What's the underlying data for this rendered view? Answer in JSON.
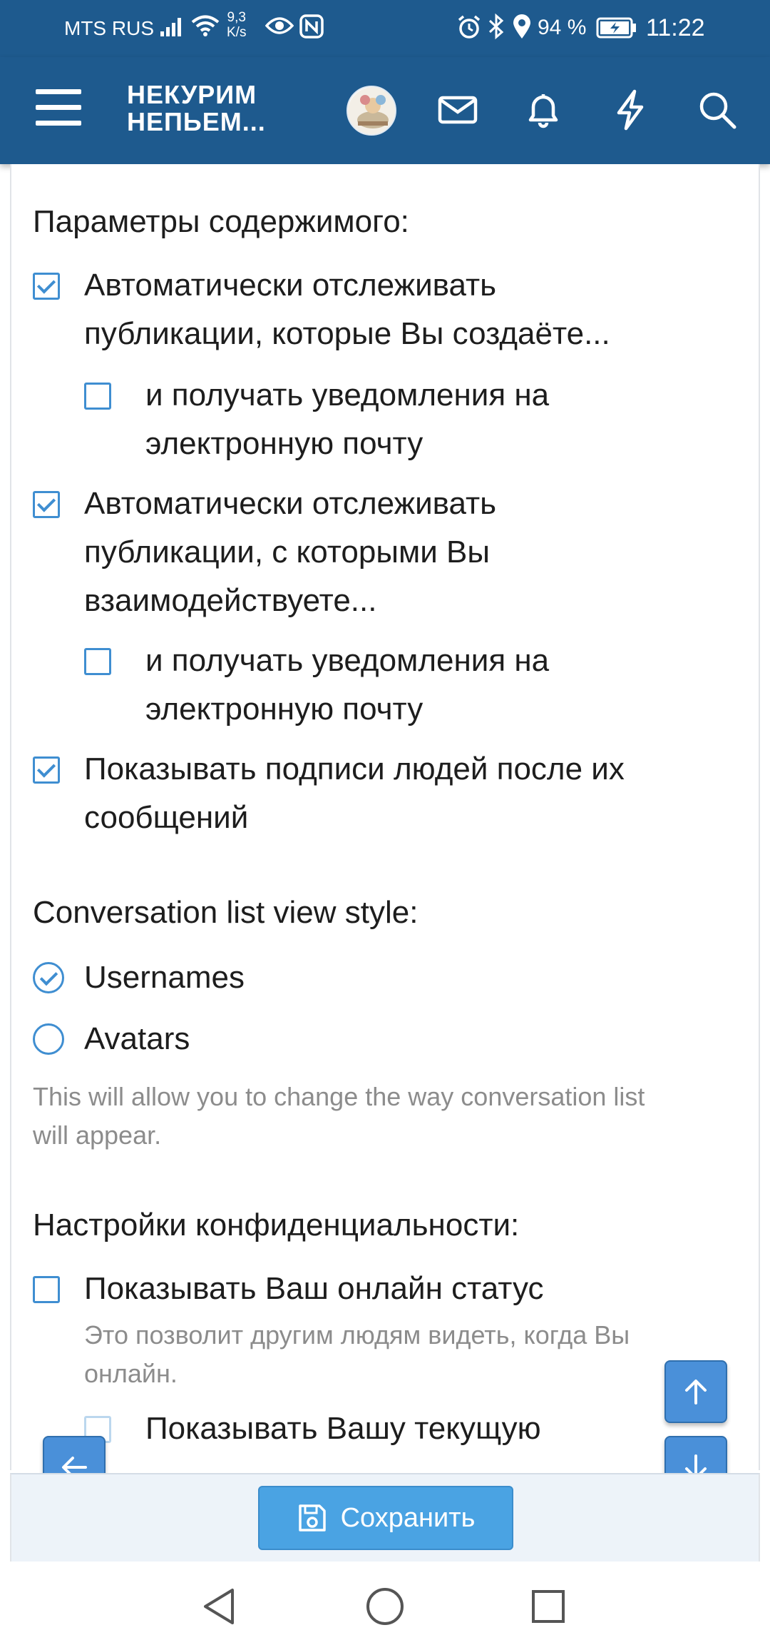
{
  "status_bar": {
    "carrier": "MTS RUS",
    "speed_value": "9,3",
    "speed_unit": "K/s",
    "battery_percent": "94 %",
    "time": "11:22"
  },
  "header": {
    "logo_line1": "НЕКУРИМ",
    "logo_line2": "НЕПЬЕМ..."
  },
  "content_section": {
    "title": "Параметры содержимого:",
    "options": [
      {
        "line1": "Автоматически отслеживать",
        "line2": "публикации, которые Вы создаёте...",
        "checked": true
      },
      {
        "line1": "и получать уведомления на",
        "line2": "электронную почту",
        "checked": false
      },
      {
        "line1": "Автоматически отслеживать",
        "line2": "публикации, с которыми Вы",
        "line3": "взаимодействуете...",
        "checked": true
      },
      {
        "line1": "и получать уведомления на",
        "line2": "электронную почту",
        "checked": false
      },
      {
        "line1": "Показывать подписи людей после их",
        "line2": "сообщений",
        "checked": true
      }
    ]
  },
  "conversation_section": {
    "title": "Conversation list view style:",
    "options": [
      {
        "label": "Usernames",
        "selected": true
      },
      {
        "label": "Avatars",
        "selected": false
      }
    ],
    "hint_line1": "This will allow you to change the way conversation list",
    "hint_line2": "will appear."
  },
  "privacy_section": {
    "title": "Настройки конфиденциальности:",
    "online_status": {
      "label": "Показывать Ваш онлайн статус",
      "checked": false
    },
    "online_hint_line1": "Это позволит другим людям видеть, когда Вы",
    "online_hint_line2": "онлайн.",
    "current_activity": {
      "label": "Показывать Вашу текущую",
      "checked": false
    }
  },
  "save_button": {
    "label": "Сохранить"
  },
  "colors": {
    "header_bg": "#1e5a8e",
    "accent": "#3f8ed1",
    "button": "#4aa3e3"
  }
}
